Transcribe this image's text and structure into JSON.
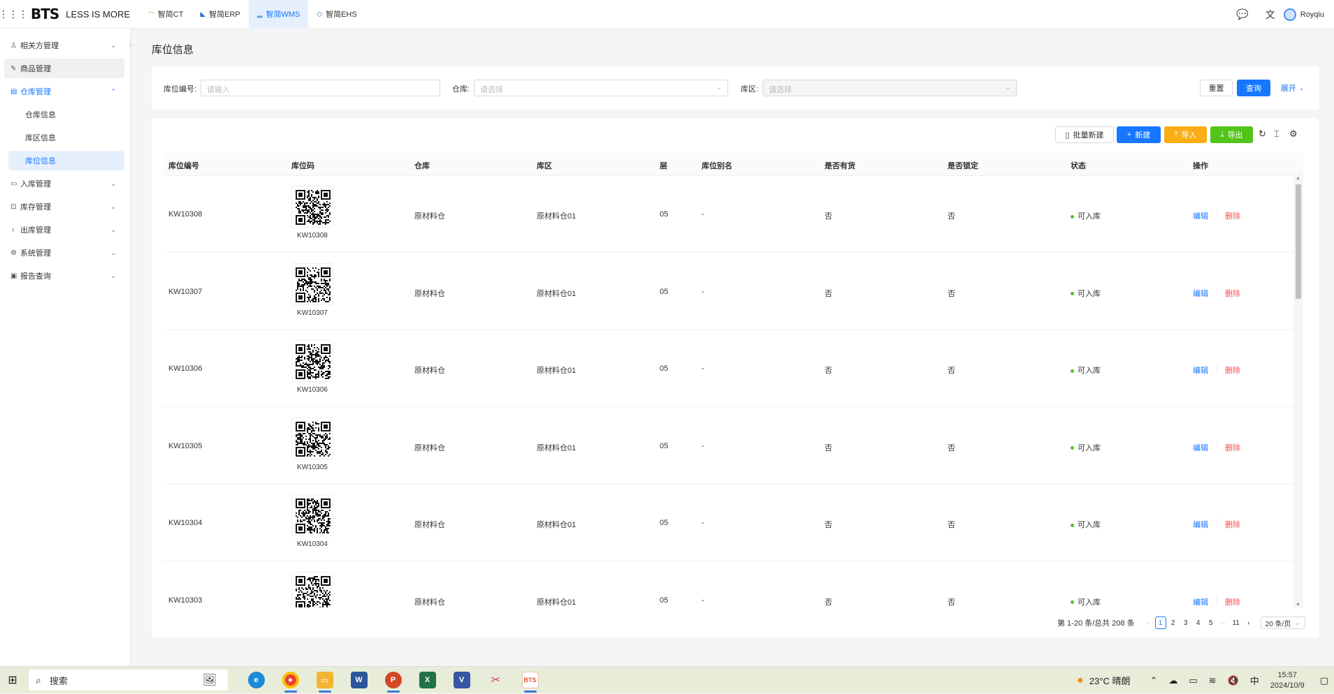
{
  "topbar": {
    "logo": "BTS",
    "slogan": "LESS IS MORE",
    "apps": [
      {
        "label": "智简CT",
        "icon": "◠",
        "active": false
      },
      {
        "label": "智简ERP",
        "icon": "◣",
        "active": false
      },
      {
        "label": "智简WMS",
        "icon": "▂",
        "active": true
      },
      {
        "label": "智简EHS",
        "icon": "◇",
        "active": false
      }
    ],
    "user": "Royqiu"
  },
  "sidebar": {
    "items": [
      {
        "label": "相关方管理",
        "icon": "♙"
      },
      {
        "label": "商品管理",
        "icon": "✎"
      },
      {
        "label": "仓库管理",
        "icon": "▤"
      },
      {
        "label": "入库管理",
        "icon": "▭"
      },
      {
        "label": "库存管理",
        "icon": "⊡"
      },
      {
        "label": "出库管理",
        "icon": "♁"
      },
      {
        "label": "系统管理",
        "icon": "⚙"
      },
      {
        "label": "报告查询",
        "icon": "▣"
      }
    ],
    "sub_items": [
      "仓库信息",
      "库区信息",
      "库位信息"
    ]
  },
  "page": {
    "title": "库位信息"
  },
  "filters": {
    "code_label": "库位编号:",
    "code_placeholder": "请输入",
    "warehouse_label": "仓库:",
    "warehouse_placeholder": "请选择",
    "zone_label": "库区:",
    "zone_placeholder": "请选择",
    "reset": "重置",
    "search": "查询",
    "expand": "展开"
  },
  "toolbar": {
    "batch_new": "批量新建",
    "new": "新建",
    "import": "导入",
    "export": "导出"
  },
  "table": {
    "columns": [
      "库位编号",
      "库位码",
      "仓库",
      "库区",
      "层",
      "库位别名",
      "是否有货",
      "是否锁定",
      "状态",
      "操作"
    ],
    "rows": [
      {
        "code": "KW10308",
        "qr_label": "KW10308",
        "warehouse": "原材料仓",
        "zone": "原材料仓01",
        "layer": "05",
        "alias": "-",
        "has_goods": "否",
        "locked": "否",
        "status": "可入库",
        "edit": "编辑",
        "delete": "删除"
      },
      {
        "code": "KW10307",
        "qr_label": "KW10307",
        "warehouse": "原材料仓",
        "zone": "原材料仓01",
        "layer": "05",
        "alias": "-",
        "has_goods": "否",
        "locked": "否",
        "status": "可入库",
        "edit": "编辑",
        "delete": "删除"
      },
      {
        "code": "KW10306",
        "qr_label": "KW10306",
        "warehouse": "原材料仓",
        "zone": "原材料仓01",
        "layer": "05",
        "alias": "-",
        "has_goods": "否",
        "locked": "否",
        "status": "可入库",
        "edit": "编辑",
        "delete": "删除"
      },
      {
        "code": "KW10305",
        "qr_label": "KW10305",
        "warehouse": "原材料仓",
        "zone": "原材料仓01",
        "layer": "05",
        "alias": "-",
        "has_goods": "否",
        "locked": "否",
        "status": "可入库",
        "edit": "编辑",
        "delete": "删除"
      },
      {
        "code": "KW10304",
        "qr_label": "KW10304",
        "warehouse": "原材料仓",
        "zone": "原材料仓01",
        "layer": "05",
        "alias": "-",
        "has_goods": "否",
        "locked": "否",
        "status": "可入库",
        "edit": "编辑",
        "delete": "删除"
      },
      {
        "code": "KW10303",
        "qr_label": "",
        "warehouse": "原材料仓",
        "zone": "原材料仓01",
        "layer": "05",
        "alias": "-",
        "has_goods": "否",
        "locked": "否",
        "status": "可入库",
        "edit": "编辑",
        "delete": "删除"
      }
    ]
  },
  "pagination": {
    "summary": "第 1-20 条/总共 208 条",
    "pages": [
      "1",
      "2",
      "3",
      "4",
      "5",
      "···",
      "11"
    ],
    "current": "1",
    "page_size": "20 条/页"
  },
  "taskbar": {
    "search": "搜索",
    "weather": "23°C 晴朗",
    "ime": "中",
    "time": "15:57",
    "date": "2024/10/9"
  }
}
